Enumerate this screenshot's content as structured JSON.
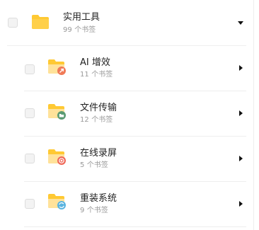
{
  "group": {
    "title": "实用工具",
    "count": "99",
    "count_unit": "个书签",
    "expanded": true,
    "icon": "folder-icon"
  },
  "items": [
    {
      "title": "AI 增效",
      "count": "11",
      "count_unit": "个书签",
      "badge_icon": "rocket-icon",
      "badge_color": "#f07a57"
    },
    {
      "title": "文件传输",
      "count": "12",
      "count_unit": "个书签",
      "badge_icon": "folder-badge-icon",
      "badge_color": "#5b9b73"
    },
    {
      "title": "在线录屏",
      "count": "5",
      "count_unit": "个书签",
      "badge_icon": "record-icon",
      "badge_color": "#f06a5a"
    },
    {
      "title": "重装系统",
      "count": "9",
      "count_unit": "个书签",
      "badge_icon": "sync-icon",
      "badge_color": "#5ab4e0"
    }
  ],
  "colors": {
    "folder_main": "#ffc933",
    "folder_light": "#ffe29a"
  }
}
